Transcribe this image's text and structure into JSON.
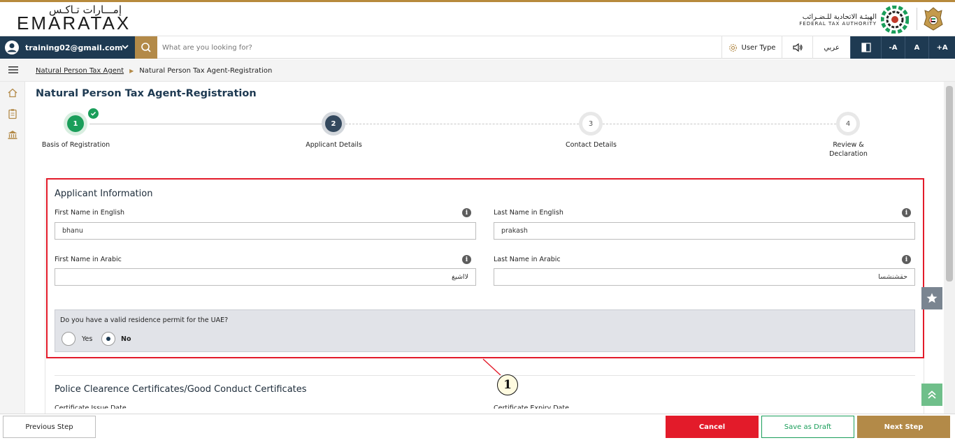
{
  "brand": {
    "logo_arabic": "إمـــارات تـاكـس",
    "logo_english": "EMARATAX",
    "fta_arabic": "الهيئـة الاتحادية للـضـرائب",
    "fta_english": "FEDERAL TAX AUTHORITY"
  },
  "toolbar": {
    "user_email": "training02@gmail.com",
    "search_placeholder": "What are you looking for?",
    "user_type": "User Type",
    "language": "عربي",
    "font_decrease": "-A",
    "font_normal": "A",
    "font_increase": "+A"
  },
  "breadcrumb": {
    "parent": "Natural Person Tax Agent",
    "current": "Natural Person Tax Agent-Registration"
  },
  "page_title": "Natural Person Tax Agent-Registration",
  "stepper": {
    "steps": [
      {
        "number": "1",
        "label": "Basis of Registration",
        "status": "completed"
      },
      {
        "number": "2",
        "label": "Applicant Details",
        "status": "active"
      },
      {
        "number": "3",
        "label": "Contact Details",
        "status": "pending"
      },
      {
        "number": "4",
        "label": "Review &\nDeclaration",
        "status": "pending"
      }
    ]
  },
  "applicant_info": {
    "title": "Applicant Information",
    "first_name_en_label": "First Name in English",
    "first_name_en_value": "bhanu",
    "last_name_en_label": "Last Name in English",
    "last_name_en_value": "prakash",
    "first_name_ar_label": "First Name in Arabic",
    "first_name_ar_value": "لااشيغ",
    "last_name_ar_label": "Last Name in Arabic",
    "last_name_ar_value": "حقشنشسا",
    "residence_question": "Do you have a valid residence permit for the UAE?",
    "residence_options": [
      "Yes",
      "No"
    ],
    "residence_selected": "No"
  },
  "callout_number": "1",
  "police_section": {
    "title": "Police Clearence Certificates/Good Conduct Certificates",
    "issue_date_label": "Certificate Issue Date",
    "expiry_date_label": "Certificate Expiry Date"
  },
  "footer": {
    "previous": "Previous Step",
    "cancel": "Cancel",
    "save_draft": "Save as Draft",
    "next": "Next Step"
  },
  "colors": {
    "navy": "#1e3a52",
    "gold": "#b38a48",
    "green": "#1a9e5a",
    "red": "#e31b2a"
  }
}
